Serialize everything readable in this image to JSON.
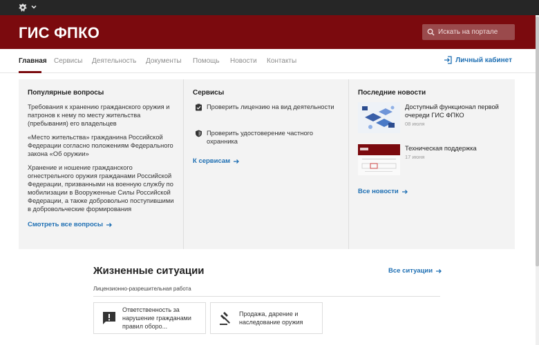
{
  "topbar": {
    "emblem_icon": "coat-of-arms-icon",
    "chevron_icon": "chevron-down-icon"
  },
  "header": {
    "title": "ГИС ФПКО",
    "search_placeholder": "Искать на портале",
    "brand_color": "#7b0a0e"
  },
  "nav": {
    "items": [
      {
        "label": "Главная",
        "active": true
      },
      {
        "label": "Сервисы"
      },
      {
        "label": "Деятельность"
      },
      {
        "label": "Документы"
      },
      {
        "label": "Помощь"
      },
      {
        "label": "Новости"
      },
      {
        "label": "Контакты"
      }
    ],
    "cabinet_label": "Личный кабинет"
  },
  "popular": {
    "title": "Популярные вопросы",
    "questions": [
      "Требования к хранению гражданского оружия и патронов к нему по месту жительства (пребывания) его владельцев",
      "«Место жительства» гражданина Российской Федерации согласно положениям Федерального закона «Об оружии»",
      "Хранение и ношение гражданского огнестрельного оружия гражданами Российской Федерации, призванными на военную службу по мобилизации в Вооруженные Силы Российской Федерации, а также добровольно поступившими в добровольческие формирования"
    ],
    "all_link": "Смотреть все вопросы"
  },
  "services": {
    "title": "Сервисы",
    "items": [
      {
        "label": "Проверить лицензию на вид деятельности",
        "icon": "verified-doc-icon"
      },
      {
        "label": "Проверить удостоверение частного охранника",
        "icon": "shield-icon"
      }
    ],
    "all_link": "К сервисам"
  },
  "news": {
    "title": "Последние новости",
    "items": [
      {
        "title": "Доступный функционал первой очереди ГИС ФПКО",
        "date": "08 июля"
      },
      {
        "title": "Техническая поддержка",
        "date": "17 июня"
      }
    ],
    "all_link": "Все новости"
  },
  "life": {
    "title": "Жизненные ситуации",
    "all_link": "Все ситуации",
    "category": "Лицензионно-разрешительная работа",
    "cards": [
      {
        "label": "Ответственность за нарушение гражданами правил оборо...",
        "icon": "alert-message-icon"
      },
      {
        "label": "Продажа, дарение и наследование оружия",
        "icon": "gavel-icon"
      }
    ]
  }
}
